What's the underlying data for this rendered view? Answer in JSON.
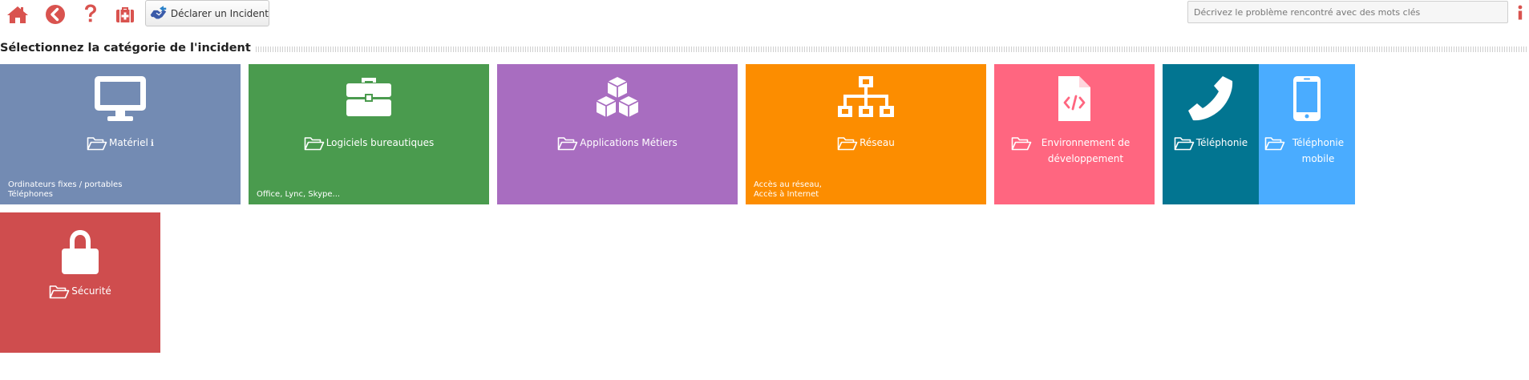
{
  "toolbar": {
    "icons": [
      "home-icon",
      "back-icon",
      "help-icon",
      "first-aid-kit-icon"
    ],
    "declare_label": "Déclarer un Incident",
    "search_placeholder": "Décrivez le problème rencontré avec des mots clés"
  },
  "section": {
    "title": "Sélectionnez la catégorie de l'incident"
  },
  "colors": {
    "accent_red": "#d9534f",
    "materiel": "#738bb3",
    "logiciels": "#4a9b4e",
    "applications": "#a86dc0",
    "reseau": "#fc8d00",
    "environnement": "#ff6680",
    "telephonie": "#027591",
    "telephonie_mobile": "#4aacff",
    "securite": "#cf4d4e"
  },
  "tiles": {
    "materiel": {
      "label": "Matériel",
      "info": "ℹ",
      "icon": "monitor-icon",
      "desc": [
        "Ordinateurs fixes / portables",
        "Téléphones"
      ]
    },
    "logiciels": {
      "label": "Logiciels bureautiques",
      "icon": "toolbox-icon",
      "desc": [
        "Office, Lync, Skype..."
      ]
    },
    "applications": {
      "label": "Applications Métiers",
      "icon": "cubes-icon"
    },
    "reseau": {
      "label": "Réseau",
      "icon": "network-icon",
      "desc": [
        "Accès au réseau,",
        "Accès à Internet"
      ]
    },
    "environnement": {
      "label": "Environnement de développement",
      "icon": "code-file-icon"
    },
    "telephonie": {
      "label": "Téléphonie",
      "icon": "phone-icon"
    },
    "telephonie_mobile": {
      "label": "Téléphonie mobile",
      "icon": "mobile-phone-icon"
    },
    "securite": {
      "label": "Sécurité",
      "icon": "lock-icon"
    }
  }
}
